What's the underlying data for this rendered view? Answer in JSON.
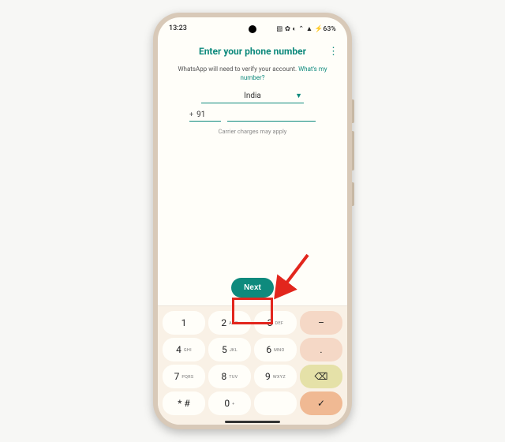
{
  "status": {
    "time": "13:23",
    "right": "▧ ✿ ◐ ⌃ ▲ ⚡63%"
  },
  "app": {
    "title": "Enter your phone number",
    "desc_prefix": "WhatsApp will need to verify your account. ",
    "desc_link": "What's my number?",
    "country": "India",
    "plus": "+",
    "code": "91",
    "carrier_note": "Carrier charges may apply",
    "next_label": "Next"
  },
  "keys": {
    "k1": {
      "n": "1",
      "s": ""
    },
    "k2": {
      "n": "2",
      "s": "ABC"
    },
    "k3": {
      "n": "3",
      "s": "DEF"
    },
    "k4": {
      "n": "4",
      "s": "GHI"
    },
    "k5": {
      "n": "5",
      "s": "JKL"
    },
    "k6": {
      "n": "6",
      "s": "MNO"
    },
    "k7": {
      "n": "7",
      "s": "PQRS"
    },
    "k8": {
      "n": "8",
      "s": "TUV"
    },
    "k9": {
      "n": "9",
      "s": "WXYZ"
    },
    "kstar": {
      "n": "* #",
      "s": ""
    },
    "k0": {
      "n": "0",
      "s": "+"
    },
    "dash": "–",
    "dot": ".",
    "backspace": "⌫",
    "enter": "✓"
  },
  "colors": {
    "accent": "#0e8a7d",
    "highlight": "#e2261d"
  }
}
